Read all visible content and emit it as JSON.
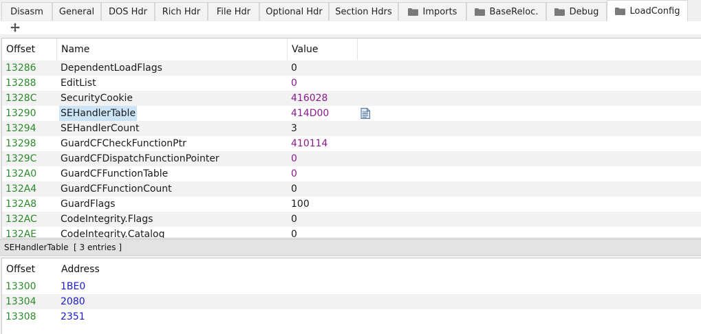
{
  "tabs": [
    {
      "label": "Disasm",
      "folder": false
    },
    {
      "label": "General",
      "folder": false
    },
    {
      "label": "DOS Hdr",
      "folder": false
    },
    {
      "label": "Rich Hdr",
      "folder": false
    },
    {
      "label": "File Hdr",
      "folder": false
    },
    {
      "label": "Optional Hdr",
      "folder": false
    },
    {
      "label": "Section Hdrs",
      "folder": false
    },
    {
      "label": "Imports",
      "folder": true
    },
    {
      "label": "BaseReloc.",
      "folder": true
    },
    {
      "label": "Debug",
      "folder": true
    },
    {
      "label": "LoadConfig",
      "folder": true,
      "active": true
    }
  ],
  "toolbar": {
    "move_icon": "move-arrows-icon"
  },
  "upper_table": {
    "headers": {
      "offset": "Offset",
      "name": "Name",
      "value": "Value"
    },
    "rows": [
      {
        "offset": "13286",
        "name": "DependentLoadFlags",
        "value": "0",
        "value_color": "black"
      },
      {
        "offset": "13288",
        "name": "EditList",
        "value": "0",
        "value_color": "purple"
      },
      {
        "offset": "1328C",
        "name": "SecurityCookie",
        "value": "416028",
        "value_color": "purple"
      },
      {
        "offset": "13290",
        "name": "SEHandlerTable",
        "value": "414D00",
        "value_color": "purple",
        "selected": true,
        "icon": "document-icon"
      },
      {
        "offset": "13294",
        "name": "SEHandlerCount",
        "value": "3",
        "value_color": "black"
      },
      {
        "offset": "13298",
        "name": "GuardCFCheckFunctionPtr",
        "value": "410114",
        "value_color": "purple"
      },
      {
        "offset": "1329C",
        "name": "GuardCFDispatchFunctionPointer",
        "value": "0",
        "value_color": "purple"
      },
      {
        "offset": "132A0",
        "name": "GuardCFFunctionTable",
        "value": "0",
        "value_color": "purple"
      },
      {
        "offset": "132A4",
        "name": "GuardCFFunctionCount",
        "value": "0",
        "value_color": "black"
      },
      {
        "offset": "132A8",
        "name": "GuardFlags",
        "value": "100",
        "value_color": "black"
      },
      {
        "offset": "132AC",
        "name": "CodeIntegrity.Flags",
        "value": "0",
        "value_color": "black"
      },
      {
        "offset": "132AE",
        "name": "CodeIntegrity.Catalog",
        "value": "0",
        "value_color": "black"
      }
    ]
  },
  "divider": {
    "title": "SEHandlerTable",
    "entries": "[ 3 entries ]"
  },
  "lower_table": {
    "headers": {
      "offset": "Offset",
      "address": "Address"
    },
    "rows": [
      {
        "offset": "13300",
        "address": "1BE0"
      },
      {
        "offset": "13304",
        "address": "2080"
      },
      {
        "offset": "13308",
        "address": "2351"
      }
    ]
  },
  "colors": {
    "offset": "#2a8a2a",
    "purple": "#8a1a8a",
    "address": "#1a1acc",
    "selection": "#cce4f7"
  }
}
